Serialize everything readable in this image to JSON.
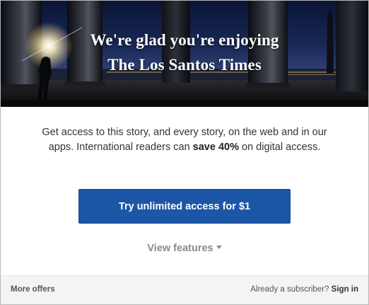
{
  "hero": {
    "title_line1": "We're glad you're enjoying",
    "title_line2": "The Los Santos Times"
  },
  "pitch": {
    "text_before": "Get access to this story, and every story, on the web and in our apps. International readers can ",
    "highlight": "save 40%",
    "text_after": " on digital access."
  },
  "cta": {
    "label": "Try unlimited access for $1"
  },
  "features": {
    "label": "View features",
    "icon": "caret-down-icon"
  },
  "footer": {
    "more_offers": "More offers",
    "subscriber_prompt": "Already a subscriber?",
    "sign_in": "Sign in"
  },
  "colors": {
    "cta_background": "#1c56a6",
    "footer_background": "#f4f4f4",
    "muted_text": "#8a8a8a"
  }
}
